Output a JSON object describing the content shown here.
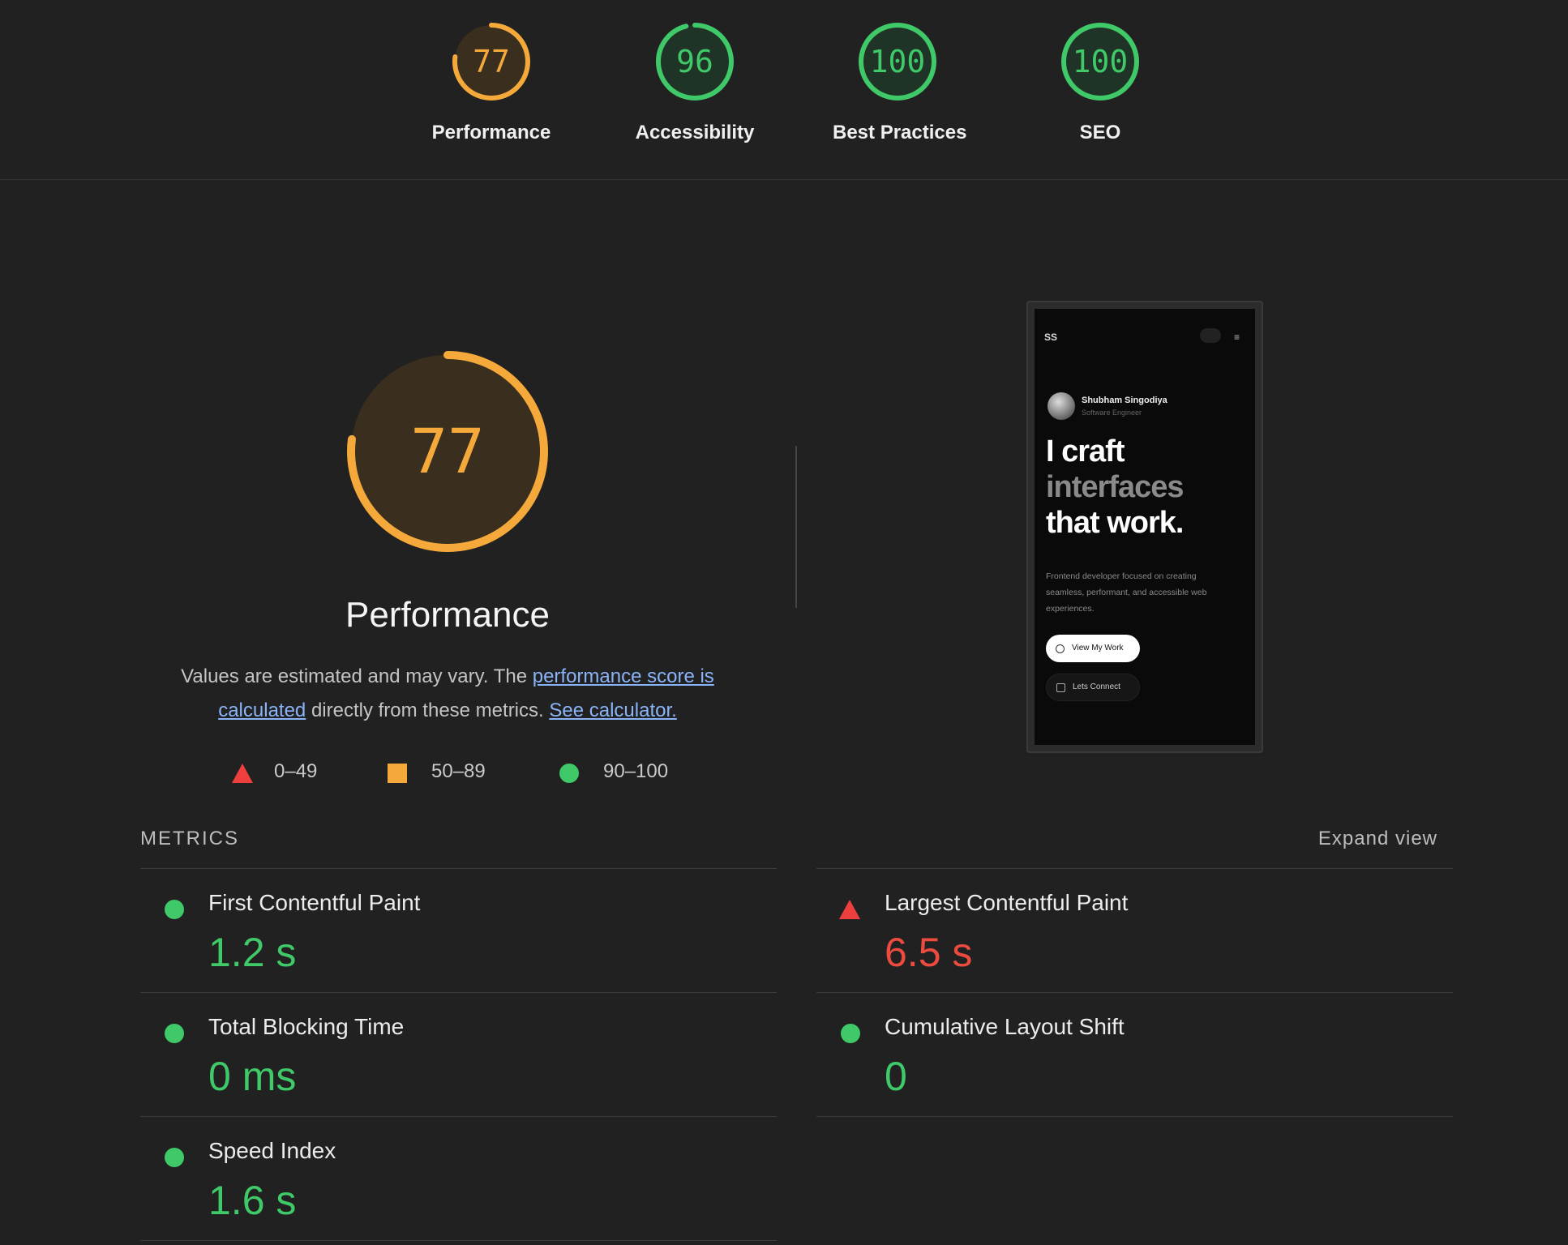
{
  "categories": [
    {
      "score": "77",
      "label": "Performance",
      "fraction": 0.77,
      "color": "#f4a93a"
    },
    {
      "score": "96",
      "label": "Accessibility",
      "fraction": 0.96,
      "color": "#3fc968"
    },
    {
      "score": "100",
      "label": "Best Practices",
      "fraction": 1.0,
      "color": "#3fc968"
    },
    {
      "score": "100",
      "label": "SEO",
      "fraction": 1.0,
      "color": "#3fc968"
    }
  ],
  "performance": {
    "score": "77",
    "fraction": 0.77,
    "title": "Performance",
    "desc_1": "Values are estimated and may vary. The ",
    "desc_link_1": "performance score is calculated",
    "desc_2": " directly from these metrics. ",
    "desc_link_2": "See calculator."
  },
  "legend": {
    "fail": "0–49",
    "average": "50–89",
    "pass": "90–100"
  },
  "screenshot": {
    "logo": "SS",
    "menu_glyph": "≡",
    "name": "Shubham Singodiya",
    "role": "Software Engineer",
    "hero_1": "I craft",
    "hero_2": "interfaces",
    "hero_3": "that work.",
    "blurb": "Frontend developer focused on creating seamless, performant, and accessible web experiences.",
    "button_primary": "View My Work",
    "button_secondary": "Lets Connect"
  },
  "metrics": {
    "heading": "METRICS",
    "expand_label": "Expand view",
    "items": [
      {
        "title": "First Contentful Paint",
        "value": "1.2 s",
        "status": "pass"
      },
      {
        "title": "Largest Contentful Paint",
        "value": "6.5 s",
        "status": "fail"
      },
      {
        "title": "Total Blocking Time",
        "value": "0 ms",
        "status": "pass"
      },
      {
        "title": "Cumulative Layout Shift",
        "value": "0",
        "status": "pass"
      },
      {
        "title": "Speed Index",
        "value": "1.6 s",
        "status": "pass"
      }
    ]
  }
}
